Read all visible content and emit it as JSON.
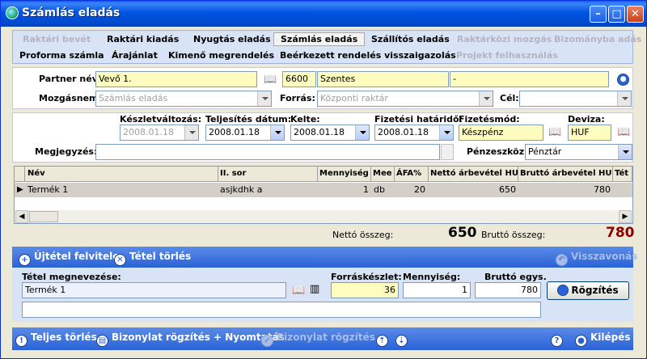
{
  "window": {
    "title": "Számlás eladás"
  },
  "tabs": {
    "row1": [
      "Raktári bevét",
      "Raktári kiadás",
      "Nyugtás eladás",
      "Számlás eladás",
      "Szállítós eladás",
      "Raktárközi mozgás",
      "Bizományba adás"
    ],
    "row2": [
      "Proforma számla",
      "Árajánlat",
      "Kimenő megrendelés",
      "Beérkezett rendelés visszaigazolás",
      "Projekt felhasználás"
    ]
  },
  "partner": {
    "label_partner": "Partner név:",
    "partner_value": "Vevő 1.",
    "zip": "6600",
    "city": "Szentes",
    "address": "-",
    "label_mozgasnem": "Mozgásnem:",
    "mozgasnem_value": "Számlás eladás",
    "label_forras": "Forrás:",
    "forras_value": "Központi raktár",
    "label_cel": "Cél:",
    "cel_value": ""
  },
  "dates": {
    "label_keszlet": "Készletváltozás:",
    "keszlet_value": "2008.01.18",
    "label_teljesites": "Teljesítés dátum:",
    "teljesites_value": "2008.01.18",
    "label_kelte": "Kelte:",
    "kelte_value": "2008.01.18",
    "label_hatarido": "Fizetési határidő:",
    "hatarido_value": "2008.01.18",
    "label_fizmod": "Fizetésmód:",
    "fizmod_value": "Készpénz",
    "label_deviza": "Deviza:",
    "deviza_value": "HUF",
    "label_megjegyzes": "Megjegyzés:",
    "megjegyzes_value": "",
    "label_penzeszkoz": "Pénzeszköz:",
    "penzeszkoz_value": "Pénztár"
  },
  "grid": {
    "headers": [
      "Név",
      "II. sor",
      "Mennyiség",
      "Mee",
      "ÁFA%",
      "Nettó árbevétel HUF",
      "Bruttó árbevétel HUF",
      "Tét"
    ],
    "rows": [
      [
        "Termék 1",
        "asjkdhk a",
        "1",
        "db",
        "20",
        "650",
        "780"
      ]
    ]
  },
  "totals": {
    "label_netto": "Nettó összeg:",
    "netto_value": "650",
    "label_brutto": "Bruttó összeg:",
    "brutto_value": "780"
  },
  "toolbar": {
    "new_item": "Újtétel felvitele",
    "delete_item": "Tétel törlés",
    "undo": "Visszavonás"
  },
  "item_edit": {
    "label_name": "Tétel megnevezése:",
    "name_value": "Termék 1",
    "label_stock": "Forráskészlet:",
    "stock_value": "36",
    "label_qty": "Mennyiség:",
    "qty_value": "1",
    "label_unit_price": "Bruttó egys.",
    "unit_price_value": "780",
    "save_label": "Rögzítés",
    "note_value": ""
  },
  "bottom": {
    "full_delete": "Teljes törlés",
    "save_print": "Bizonylat rögzítés + Nyomtatás",
    "save": "Bizonylat rögzítés",
    "exit": "Kilépés"
  },
  "colors": {
    "titlebar": "#0054E3",
    "brutto": "#8b0000",
    "toolbar": "#2a63d7"
  }
}
